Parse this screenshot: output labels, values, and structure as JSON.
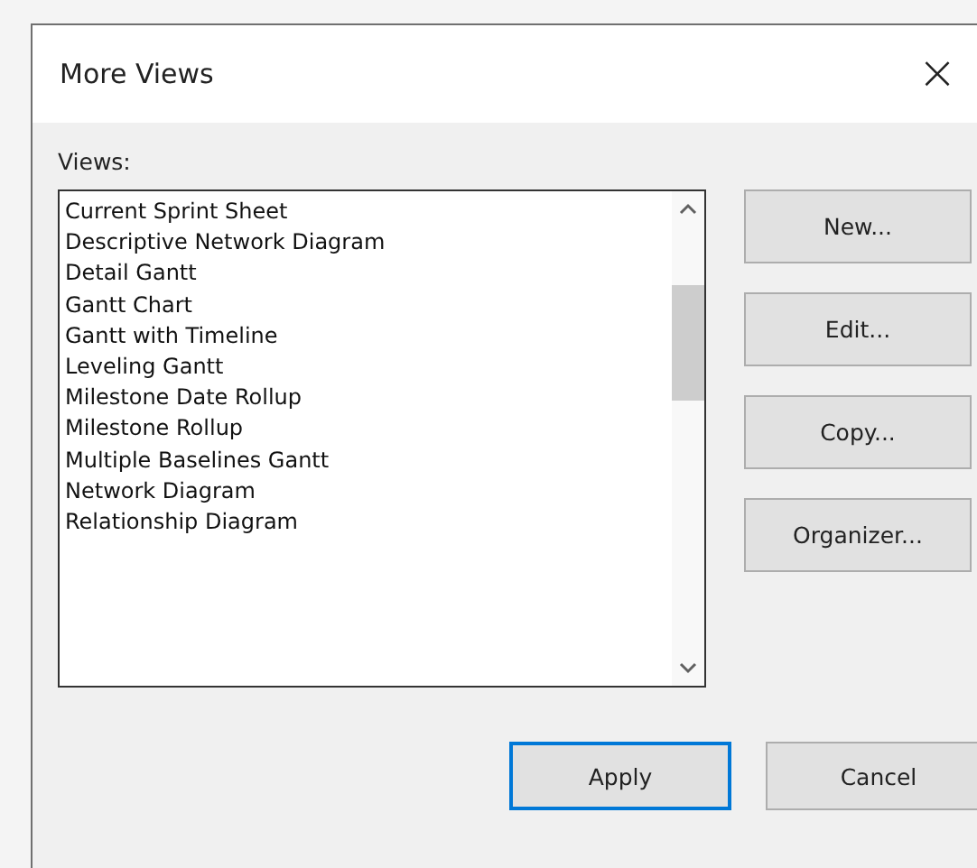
{
  "window": {
    "title": "More Views",
    "close": "×"
  },
  "views_label": "Views:",
  "views": [
    {
      "label": "Current Sprint Sheet",
      "selected": false
    },
    {
      "label": "Descriptive Network Diagram",
      "selected": false
    },
    {
      "label": "Detail Gantt",
      "selected": false
    },
    {
      "label": "Gantt Chart",
      "selected": false
    },
    {
      "label": "Gantt with Timeline",
      "selected": false
    },
    {
      "label": "Leveling Gantt",
      "selected": false
    },
    {
      "label": "Milestone Date Rollup",
      "selected": false
    },
    {
      "label": "Milestone Rollup",
      "selected": false
    },
    {
      "label": "Multiple Baselines Gantt",
      "selected": false
    },
    {
      "label": "Network Diagram",
      "selected": false
    },
    {
      "label": "Relationship Diagram",
      "selected": false
    }
  ],
  "side_buttons": [
    "New...",
    "Edit...",
    "Copy...",
    "Organizer..."
  ],
  "footer_buttons": [
    {
      "label": "Apply",
      "default": true
    },
    {
      "label": "Cancel",
      "default": false
    }
  ]
}
